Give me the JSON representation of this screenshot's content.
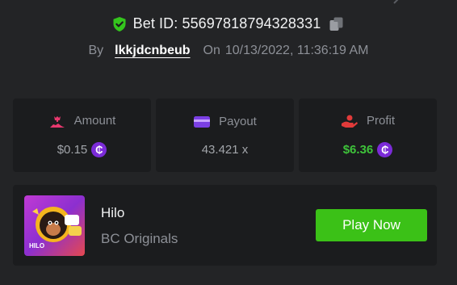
{
  "header": {
    "bet_id_text": "Bet ID: 55697818794328331",
    "by_label": "By",
    "username": "lkkjdcnbeub",
    "on_label": "On",
    "datetime": "10/13/2022, 11:36:19 AM"
  },
  "stats": {
    "amount_label": "Amount",
    "amount_value": "$0.15",
    "payout_label": "Payout",
    "payout_value": "43.421 x",
    "profit_label": "Profit",
    "profit_value": "$6.36"
  },
  "game": {
    "name": "Hilo",
    "provider": "BC Originals",
    "thumbnail_label": "HILO",
    "play_label": "Play Now"
  },
  "icons": {
    "shield": "shield-check-icon",
    "copy": "copy-icon",
    "amount": "money-bag-icon",
    "payout": "card-icon",
    "profit": "hand-coin-icon",
    "coin": "bc-coin-icon"
  },
  "colors": {
    "background": "#232426",
    "card": "#1b1c1e",
    "accent_green": "#3bc117",
    "profit_green": "#3ec33a",
    "coin_purple": "#7b2bd8"
  }
}
